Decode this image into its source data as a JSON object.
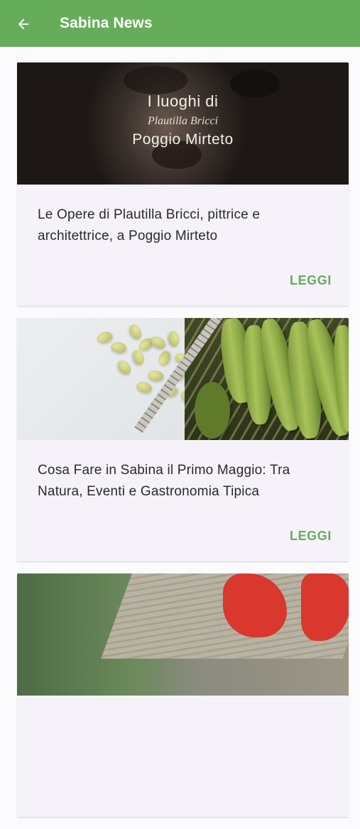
{
  "appbar": {
    "title": "Sabina News",
    "back_icon": "arrow-left-icon",
    "color": "#66ad5a"
  },
  "articles": [
    {
      "image_text": {
        "line1": "I luoghi di",
        "line2": "Plautilla Bricci",
        "line3": "Poggio Mirteto"
      },
      "title": "Le Opere di Plautilla Bricci, pittrice e architettrice, a Poggio Mirteto",
      "action": "LEGGI"
    },
    {
      "title": "Cosa Fare in Sabina il Primo Maggio: Tra Natura, Eventi e Gastronomia Tipica",
      "action": "LEGGI"
    }
  ],
  "accent_color": "#66ad5a"
}
